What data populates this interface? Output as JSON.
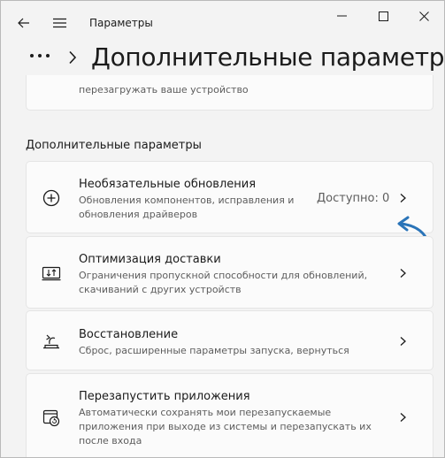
{
  "titlebar": {
    "title": "Параметры",
    "back_icon": "back-arrow-icon",
    "menu_icon": "hamburger-menu-icon",
    "minimize_icon": "minimize-icon",
    "maximize_icon": "maximize-icon",
    "close_icon": "close-icon"
  },
  "header": {
    "more_icon": "more-dots-icon",
    "separator_icon": "chevron-right-icon",
    "title": "Дополнительные параметры"
  },
  "partial_card": {
    "desc": "перезагружать ваше устройство"
  },
  "section": {
    "label": "Дополнительные параметры"
  },
  "items": [
    {
      "title": "Необязательные обновления",
      "desc_lines": [
        "Обновления компонентов, исправления и",
        "обновления драйверов"
      ],
      "value": "Доступно: 0",
      "icon": "plus-circle-icon"
    },
    {
      "title": "Оптимизация доставки",
      "desc_lines": [
        "Ограничения пропускной способности для обновлений,",
        "скачиваний с других устройств"
      ],
      "icon": "delivery-optimization-icon"
    },
    {
      "title": "Восстановление",
      "desc_lines": [
        "Сброс, расширенные параметры запуска, вернуться"
      ],
      "icon": "recovery-icon"
    },
    {
      "title": "Перезапустить приложения",
      "desc_lines": [
        "Автоматически сохранять мои перезапускаемые",
        "приложения при выходе из системы и перезапускать их",
        "после входа"
      ],
      "icon": "restart-apps-icon"
    }
  ],
  "colors": {
    "background": "#f3f3f3",
    "card": "#fbfbfb",
    "annotation_arrow": "#2a74b8"
  }
}
